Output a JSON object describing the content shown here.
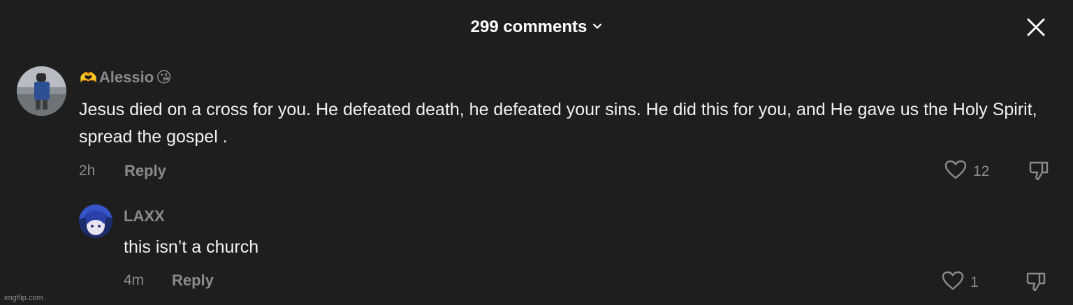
{
  "header": {
    "title": "299 comments",
    "chevron_icon": "chevron-down-icon",
    "close_icon": "close-icon"
  },
  "comments": [
    {
      "username": "Alessio",
      "username_prefix_emoji": "🫶",
      "username_suffix_emoji": "😘",
      "text": "Jesus died on a cross for you. He defeated death, he defeated your sins. He did this for you, and He gave us the Holy Spirit, spread the gospel .",
      "time": "2h",
      "reply_label": "Reply",
      "like_count": "12",
      "like_icon": "heart-icon",
      "dislike_icon": "thumbs-down-icon"
    },
    {
      "username": "LAXX",
      "text": "this isn’t a church",
      "time": "4m",
      "reply_label": "Reply",
      "like_count": "1",
      "like_icon": "heart-icon",
      "dislike_icon": "thumbs-down-icon"
    }
  ],
  "watermark": "imgflip.com",
  "colors": {
    "background": "#1e1e1e",
    "text": "#f2f2f2",
    "muted": "#8b8b8b"
  }
}
